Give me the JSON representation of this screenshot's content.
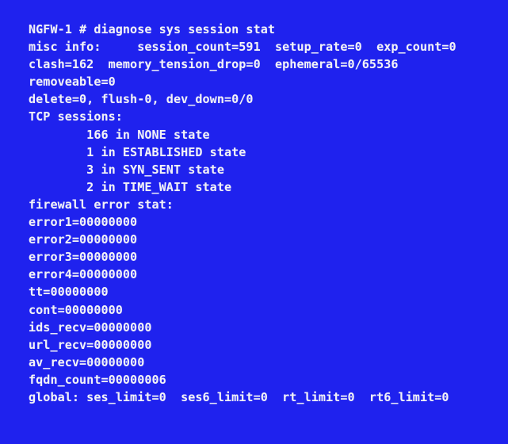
{
  "terminal": {
    "background_color": "#1f22ee",
    "text_color": "#f2f2f7",
    "prompt_host": "NGFW-1",
    "prompt_symbol": "#",
    "command": "diagnose sys session stat",
    "lines": [
      "NGFW-1 # diagnose sys session stat",
      "misc info:     session_count=591  setup_rate=0  exp_count=0",
      "clash=162  memory_tension_drop=0  ephemeral=0/65536",
      "removeable=0",
      "delete=0, flush-0, dev_down=0/0",
      "TCP sessions:",
      "        166 in NONE state",
      "        1 in ESTABLISHED state",
      "        3 in SYN_SENT state",
      "        2 in TIME_WAIT state",
      "firewall error stat:",
      "error1=00000000",
      "error2=00000000",
      "error3=00000000",
      "error4=00000000",
      "tt=00000000",
      "cont=00000000",
      "ids_recv=00000000",
      "url_recv=00000000",
      "av_recv=00000000",
      "fqdn_count=00000006",
      "global: ses_limit=0  ses6_limit=0  rt_limit=0  rt6_limit=0"
    ],
    "stats": {
      "misc_info": {
        "session_count": "591",
        "setup_rate": "0",
        "exp_count": "0",
        "clash": "162",
        "memory_tension_drop": "0",
        "ephemeral": "0/65536",
        "removeable": "0",
        "delete": "0",
        "flush": "0",
        "dev_down": "0/0"
      },
      "tcp_sessions": [
        {
          "count": "166",
          "state": "NONE"
        },
        {
          "count": "1",
          "state": "ESTABLISHED"
        },
        {
          "count": "3",
          "state": "SYN_SENT"
        },
        {
          "count": "2",
          "state": "TIME_WAIT"
        }
      ],
      "firewall_error_stat": {
        "error1": "00000000",
        "error2": "00000000",
        "error3": "00000000",
        "error4": "00000000",
        "tt": "00000000",
        "cont": "00000000",
        "ids_recv": "00000000",
        "url_recv": "00000000",
        "av_recv": "00000000",
        "fqdn_count": "00000006"
      },
      "global": {
        "ses_limit": "0",
        "ses6_limit": "0",
        "rt_limit": "0",
        "rt6_limit": "0"
      }
    }
  }
}
